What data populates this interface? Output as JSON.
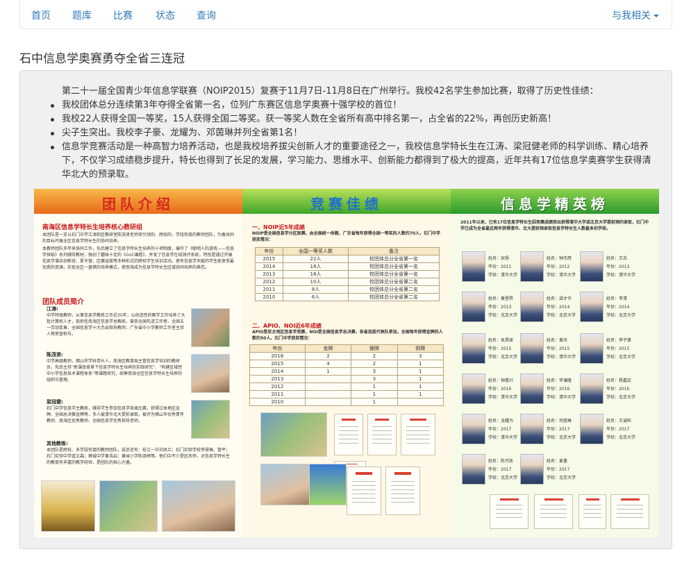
{
  "nav": {
    "items": [
      "首页",
      "题库",
      "比赛",
      "状态",
      "查询"
    ],
    "right": "与我相关"
  },
  "title": "石中信息学奥赛勇夺全省三连冠",
  "article": {
    "intro": "第二十一届全国青少年信息学联赛（NOIP2015）复赛于11月7日-11月8日在广州举行。我校42名学生参加比赛，取得了历史性佳绩：",
    "bullets": [
      "我校团体总分连续第3年夺得全省第一名，位列广东赛区信息学奥赛十强学校的首位！",
      "我校22人获得全国一等奖，15人获得全国二等奖。获一等奖人数在全省所有高中排名第一，占全省的22%，再创历史新高！",
      "尖子生突出。我校李子豪、龙耀为、邓茵琳并列全省第1名！",
      "信息学竞赛活动是一种高智力培养活动，也是我校培养拔尖创新人才的重要途径之一，我校信息学特长生在江涛、梁冠健老师的科学训练、精心培养下，不仅学习成绩稳步提升，特长也得到了长足的发展，学习能力、思维水平、创新能力都得到了极大的提高，近年共有17位信息学奥赛学生获得清华北大的预录取。"
    ]
  },
  "poster": {
    "panel1": {
      "title": "团队介绍",
      "heading": "南海区信息学特长生培养核心教研组",
      "body": "本团队是一支以石门中学江涛和区教研室陈茂贤老师双引领的、跨校的、学段衔接的教师团队，为着共同的目标开展全区信息学特长生的协同培养。",
      "body2": "本教师团队多年来协同工作，先后建立了信息学特长生培养的十项制度，编写了《聪明人的游戏——信息学探秘》系列辅导教材，独创了趣味十足的《GoC编程》，并发了信息学在线测评系统，特别是通过开展信息学课余创新班、夏令营、区赛选拔等多种形式的跨校学生培训活动，使有信息学天赋的学生能享受最优质的资源，实现全区一盘棋的培养模式，使南海成为信息学特长生区域协同培养的典范。",
      "members_heading": "团队成员简介",
      "m1_name": "江涛:",
      "m1_desc": "中学特级教师，从事信息学教练工作近30年，以创造性的教学工作培养了大批计算机人才，现担任南海区信息学总教练，曾获全国先进工作者、全国五一劳动奖章、全国信息学十大杰出指导教师，广东省中小学教师工作室主持人等荣誉称号。",
      "m2_name": "陈茂贤:",
      "m2_desc": "中学高级教师，佛山市学科带头人，南海区教育局主管信息学培训的教研员，先后主持“新课改背景下信息学特长生培养的实践研究”、“构建区域性中小学信息技术课程体系”等课题研究，统筹南海全区信息学特长生培养的组织与管理。",
      "m3_name": "梁冠健:",
      "m3_desc": "石门中学信息学主教练，辅导学生参加信息学各级比赛，获得过本地区金牌、全国总决赛金牌等，多人被清华北大提前录取，被评为佛山市优秀青年教师、南海区优秀教师、全国信息学优秀指导老师。",
      "m4_name": "其他教练:",
      "m4_desc": "本团队是跨校、多学段衔接的教师团队，成员还有：桂江一中刘凤兰；石门实验学校李慧琳、管平；石门实验中学蓝文森；狮城中学黄浩启；黄岐小学陈淑婷等。他们中不少是区名师，对信息学特长生的教育有丰富的教学经验，是团队的核心力量。"
    },
    "panel2": {
      "title": "竞赛佳绩",
      "s1_heading": "一、NOIP近5年成绩",
      "s1_desc": "NOIP是全国信息学分区联赛，由全国统一命题，广东省每年获得全国一等奖的人数约70人，石门中学获奖情况：",
      "t1_headers": [
        "年份",
        "全国一等奖人数",
        "备注"
      ],
      "t1_rows": [
        [
          "2015",
          "22人",
          "校团体总分全省第一名"
        ],
        [
          "2014",
          "18人",
          "校团体总分全省第一名"
        ],
        [
          "2013",
          "18人",
          "校团体总分全省第一名"
        ],
        [
          "2012",
          "10人",
          "校团体总分全省第二名"
        ],
        [
          "2011",
          "8人",
          "校团体总分全省第二名"
        ],
        [
          "2010",
          "6人",
          "校团体总分全省第二名"
        ]
      ],
      "s2_heading": "二、APIO、NOI近6年成绩",
      "s2_desc": "APIO是亚太地区信息学竞赛，NOI是全国信息学总决赛，各省选拔代表队参加，全国每年获得金牌的人数约50人。石门中学获奖情况：",
      "t2_headers": [
        "年份",
        "金牌",
        "银牌",
        "铜牌"
      ],
      "t2_rows": [
        [
          "2016",
          "2",
          "2",
          "3"
        ],
        [
          "2015",
          "4",
          "2",
          "1"
        ],
        [
          "2014",
          "1",
          "3",
          "1"
        ],
        [
          "2013",
          "",
          "3",
          "1"
        ],
        [
          "2012",
          "",
          "1",
          "1"
        ],
        [
          "2011",
          "",
          "1",
          "1"
        ],
        [
          "2010",
          "",
          "1",
          ""
        ]
      ]
    },
    "panel3": {
      "title": "信息学精英榜",
      "intro": "2011年以来，已有17位信息学特长生因竞赛成绩突出获得清华大学或北京大学提前预约录取，石门中学已成为全省最近两年获得清华、北大提前预录取信息学特长生人数最多的学校。",
      "students": [
        {
          "name": "姓名：宋扬",
          "year": "年份：2011",
          "school": "学校：清华大学"
        },
        {
          "name": "姓名：钟杰辉",
          "year": "年份：2012",
          "school": "学校：清华大学"
        },
        {
          "name": "姓名：王苏",
          "year": "年份：2013",
          "school": "学校：清华大学"
        },
        {
          "name": "姓名：黄登昇",
          "year": "年份：2013",
          "school": "学校：北京大学"
        },
        {
          "name": "姓名：梁才华",
          "year": "年份：2014",
          "school": "学校：北京大学"
        },
        {
          "name": "姓名：李清",
          "year": "年份：2014",
          "school": "学校：北京大学"
        },
        {
          "name": "姓名：吴昊原",
          "year": "年份：2015",
          "school": "学校：北京大学"
        },
        {
          "name": "姓名：黄天",
          "year": "年份：2015",
          "school": "学校：清华大学"
        },
        {
          "name": "姓名：李子豪",
          "year": "年份：2015",
          "school": "学校：北京大学"
        },
        {
          "name": "姓名：钟惠兴",
          "year": "年份：2016",
          "school": "学校：清华大学"
        },
        {
          "name": "姓名：李谦隆",
          "year": "年份：2016",
          "school": "学校：清华大学"
        },
        {
          "name": "姓名：杨嘉宏",
          "year": "年份：2016",
          "school": "学校：北京大学"
        },
        {
          "name": "姓名：龙耀为",
          "year": "年份：2017",
          "school": "学校：清华大学"
        },
        {
          "name": "姓名：邓茵琳",
          "year": "年份：2017",
          "school": "学校：北京大学"
        },
        {
          "name": "姓名：王诚科",
          "year": "年份：2017",
          "school": "学校：北京大学"
        },
        {
          "name": "姓名：陈代凯",
          "year": "年份：2017",
          "school": "学校：北京大学"
        },
        {
          "name": "姓名：麦量",
          "year": "年份：2017",
          "school": "学校：北京大学"
        }
      ]
    }
  }
}
